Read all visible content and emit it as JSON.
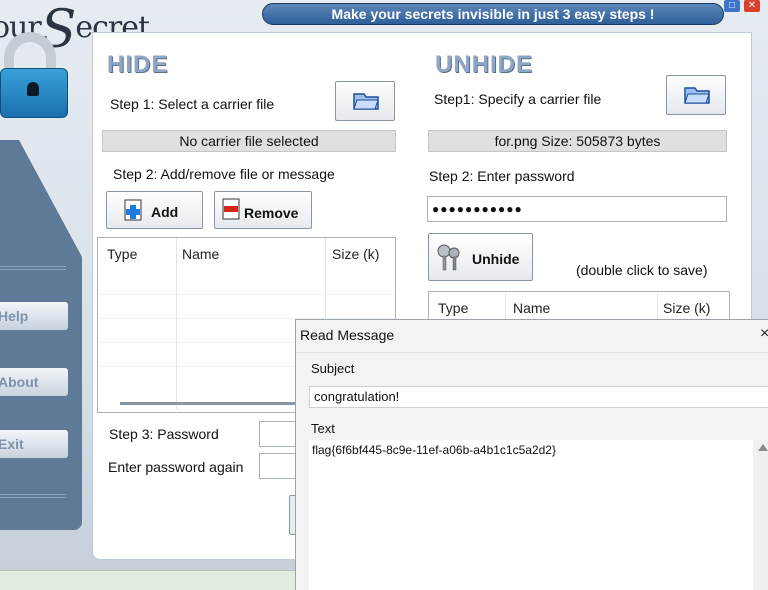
{
  "app": {
    "title_prefix": "our",
    "title_s": "S",
    "title_suffix": "ecret",
    "tagline": "Make your secrets invisible in just 3 easy steps !"
  },
  "window_buttons": {
    "maximize": "",
    "close": ""
  },
  "sidebar": {
    "items": [
      {
        "label": "Help"
      },
      {
        "label": "About"
      },
      {
        "label": "Exit"
      }
    ]
  },
  "hide": {
    "heading": "HIDE",
    "step1_label": "Step 1: Select a carrier file",
    "carrier_status": "No carrier file selected",
    "step2_label": "Step 2: Add/remove file or message",
    "add_label": "Add",
    "remove_label": "Remove",
    "table_headers": [
      "Type",
      "Name",
      "Size (k)"
    ],
    "step3_label": "Step 3: Password",
    "password_again_label": "Enter password again"
  },
  "unhide": {
    "heading": "UNHIDE",
    "step1_label": "Step1: Specify a carrier file",
    "carrier_status": "for.png   Size: 505873 bytes",
    "step2_label": "Step 2: Enter password",
    "password_masked": "●●●●●●●●●●●",
    "unhide_label": "Unhide",
    "double_click_hint": "(double click to save)",
    "table_headers": [
      "Type",
      "Name",
      "Size (k)"
    ]
  },
  "dialog": {
    "title": "Read Message",
    "close_glyph": "×",
    "subject_label": "Subject",
    "subject_value": "congratulation!",
    "text_label": "Text",
    "text_value": "flag{6f6bf445-8c9e-11ef-a06b-a4b1c1c5a2d2}"
  },
  "colors": {
    "sidebar": "#5f7a96",
    "tagline_bar": "#2f5f9a",
    "heading": "#8fa5c6",
    "lock": "#1b6fae"
  }
}
